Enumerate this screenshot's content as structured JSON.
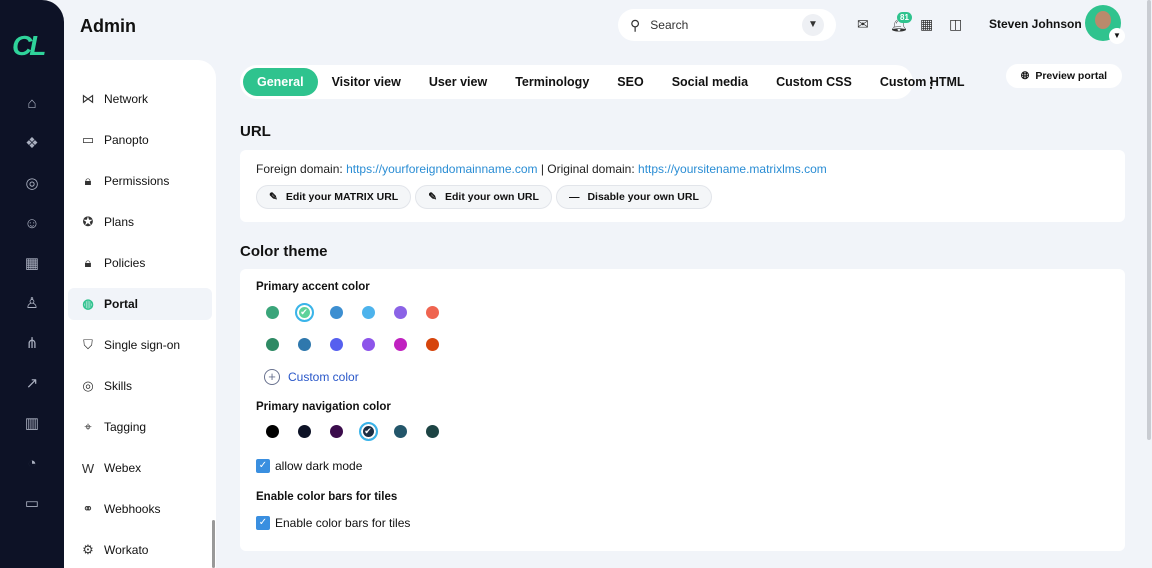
{
  "header": {
    "title": "Admin",
    "search_placeholder": "Search",
    "notification_count": "81",
    "user_name": "Steven Johnson"
  },
  "rail_icons": [
    "home-icon",
    "cubes-icon",
    "target-icon",
    "users-icon",
    "apps-icon",
    "user-icon",
    "hierarchy-icon",
    "chart-icon",
    "library-icon",
    "pie-icon",
    "id-card-icon"
  ],
  "sidebar": {
    "items": [
      {
        "label": "Network",
        "icon": "network-icon"
      },
      {
        "label": "Panopto",
        "icon": "monitor-icon"
      },
      {
        "label": "Permissions",
        "icon": "lock-icon"
      },
      {
        "label": "Plans",
        "icon": "medal-icon"
      },
      {
        "label": "Policies",
        "icon": "lock-icon"
      },
      {
        "label": "Portal",
        "icon": "globe-icon",
        "active": true
      },
      {
        "label": "Single sign-on",
        "icon": "shield-icon"
      },
      {
        "label": "Skills",
        "icon": "target-icon"
      },
      {
        "label": "Tagging",
        "icon": "tag-icon"
      },
      {
        "label": "Webex",
        "icon": "webex-icon"
      },
      {
        "label": "Webhooks",
        "icon": "webhook-icon"
      },
      {
        "label": "Workato",
        "icon": "gear-icon"
      }
    ]
  },
  "tabs": [
    "General",
    "Visitor view",
    "User view",
    "Terminology",
    "SEO",
    "Social media",
    "Custom CSS",
    "Custom HTML"
  ],
  "preview_label": "Preview portal",
  "url": {
    "heading": "URL",
    "foreign_label": "Foreign domain:",
    "foreign_url": "https://yourforeigndomainname.com",
    "sep": "| Original domain:",
    "original_url": "https://yoursitename.matrixlms.com",
    "buttons": [
      "Edit your MATRIX URL",
      "Edit your own URL",
      "Disable your own URL"
    ]
  },
  "theme": {
    "heading": "Color theme",
    "accent_label": "Primary accent color",
    "accent_colors": [
      [
        "#3aa57a",
        "#5ed29a",
        "#3d8fd1",
        "#4db3ec",
        "#8b63e6",
        "#ef6450"
      ],
      [
        "#2e8a64",
        "#2f78ad",
        "#5660ef",
        "#8d55ea",
        "#c022c0",
        "#d6450c"
      ]
    ],
    "accent_selected": [
      0,
      1
    ],
    "custom_color": "Custom color",
    "nav_label": "Primary navigation color",
    "nav_colors": [
      "#000000",
      "#0d1226",
      "#3b0c4c",
      "#1c2e44",
      "#23566a",
      "#1d4444"
    ],
    "nav_selected": 3,
    "dark_mode": "allow dark mode",
    "bars_heading": "Enable color bars for tiles",
    "bars_check": "Enable color bars for tiles"
  }
}
